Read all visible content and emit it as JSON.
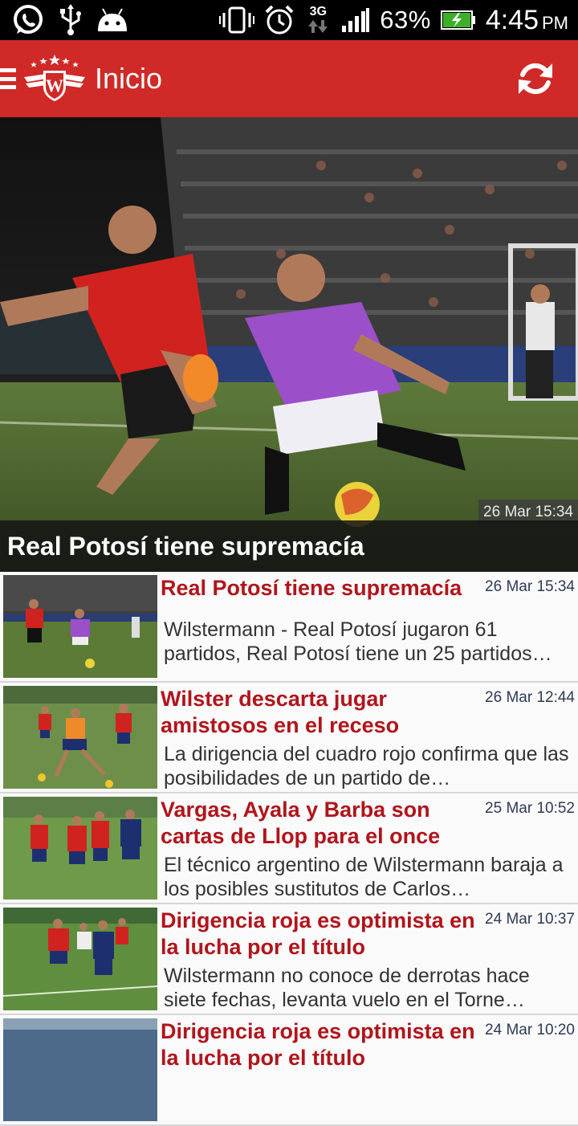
{
  "status_bar": {
    "network": "3G",
    "battery": "63%",
    "time": "4:45",
    "ampm": "PM",
    "icons": [
      "whatsapp-icon",
      "usb-icon",
      "android-icon",
      "vibrate-icon",
      "alarm-icon",
      "data-arrows-icon",
      "signal-icon",
      "battery-charging-icon"
    ]
  },
  "app_bar": {
    "title": "Inicio",
    "menu_icon": "hamburger-icon",
    "logo": "wilstermann-crest",
    "action_icon": "refresh-icon",
    "color": "#cf2a27"
  },
  "hero": {
    "date": "26 Mar 15:34",
    "title": "Real Potosí tiene supremacía"
  },
  "news": [
    {
      "title": "Real Potosí tiene supremacía",
      "date": "26 Mar 15:34",
      "summary": "Wilstermann - Real Potosí jugaron 61 partidos, Real Potosí tiene un 25 partidos…"
    },
    {
      "title": "Wilster descarta jugar amistosos en el receso",
      "date": "26 Mar 12:44",
      "summary": "La dirigencia del cuadro rojo confirma que las posibilidades de un partido de…"
    },
    {
      "title": "Vargas, Ayala y Barba son cartas de Llop para el once",
      "date": "25 Mar 10:52",
      "summary": "El técnico argentino de Wilstermann baraja a los posibles sustitutos de Carlos…"
    },
    {
      "title": "Dirigencia roja es optimista en la lucha por el título",
      "date": "24 Mar 10:37",
      "summary": "Wilstermann no conoce de derrotas hace siete fechas, levanta vuelo en el Torne…"
    },
    {
      "title": "Dirigencia roja es optimista en la lucha por el título",
      "date": "24 Mar 10:20",
      "summary": ""
    }
  ],
  "colors": {
    "title_red": "#b0151c",
    "date_blue": "#2e3a55",
    "appbar_red": "#cf2a27"
  }
}
